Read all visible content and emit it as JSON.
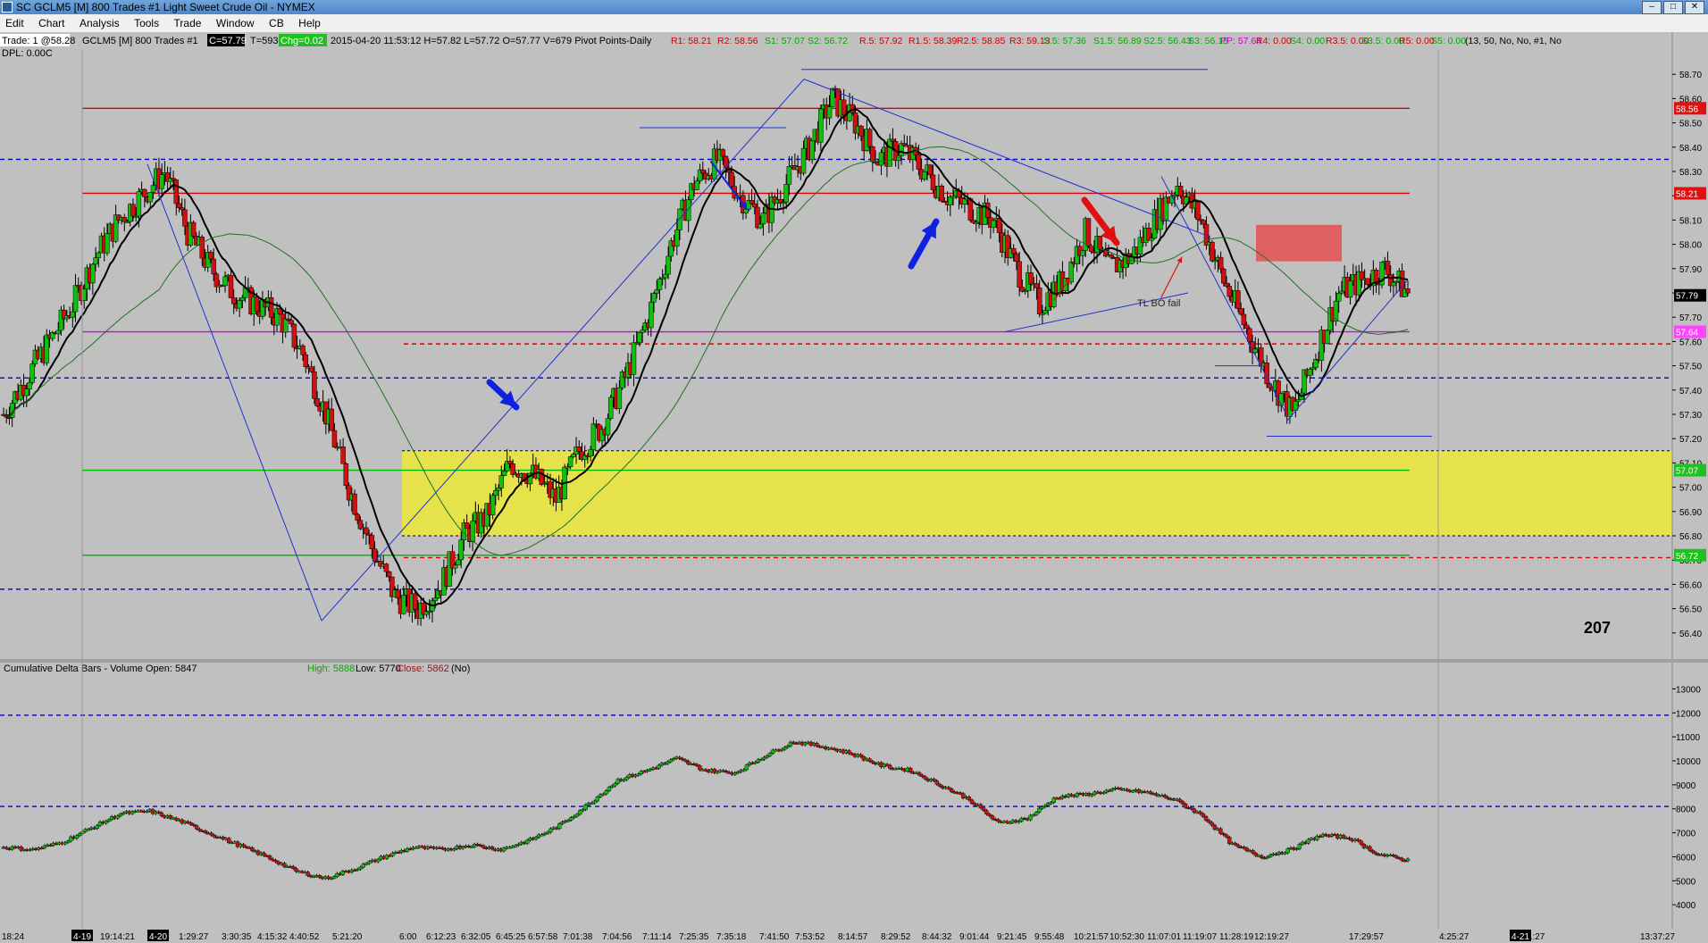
{
  "window": {
    "title": "SC GCLM5 [M]  800 Trades  #1  Light Sweet Crude Oil - NYMEX"
  },
  "menu": [
    "Edit",
    "Chart",
    "Analysis",
    "Tools",
    "Trade",
    "Window",
    "CB",
    "Help"
  ],
  "header": {
    "trade_box": "Trade: 1 @58.28",
    "dpl": "DPL: 0.00C",
    "symbol": "GCLM5 [M]  800 Trades  #1",
    "close_badge": "C=57.79",
    "t_badge": "T=593",
    "chg_badge": "Chg=0.02",
    "bar_info": "2015-04-20 11:53:12 H=57.82 L=57.72 O=57.77 V=679 Pivot Points-Daily",
    "pivots": [
      {
        "text": "R1: 58.21",
        "color": "#cc0000"
      },
      {
        "text": "R2: 58.56",
        "color": "#cc0000"
      },
      {
        "text": "S1: 57.07",
        "color": "#00aa00"
      },
      {
        "text": "S2: 56.72",
        "color": "#00aa00"
      },
      {
        "text": "R.5: 57.92",
        "color": "#cc0000"
      },
      {
        "text": "R1.5: 58.39",
        "color": "#cc0000"
      },
      {
        "text": "R2.5: 58.85",
        "color": "#cc0000"
      },
      {
        "text": "R3: 59.13",
        "color": "#cc0000"
      },
      {
        "text": "S.5: 57.36",
        "color": "#00aa00"
      },
      {
        "text": "S1.5: 56.89",
        "color": "#00aa00"
      },
      {
        "text": "S2.5: 56.43",
        "color": "#00aa00"
      },
      {
        "text": "S3: 56.15",
        "color": "#00aa00"
      },
      {
        "text": "PP: 57.64",
        "color": "#cc00cc"
      },
      {
        "text": "R4: 0.00",
        "color": "#cc0000"
      },
      {
        "text": "S4: 0.00",
        "color": "#00aa00"
      },
      {
        "text": "R3.5: 0.00",
        "color": "#cc0000"
      },
      {
        "text": "S3.5: 0.00",
        "color": "#00aa00"
      },
      {
        "text": "R5: 0.00",
        "color": "#cc0000"
      },
      {
        "text": "S5: 0.00",
        "color": "#00aa00"
      },
      {
        "text": "(13, 50, No, No, #1, No",
        "color": "#000000"
      }
    ]
  },
  "lower_header": {
    "title": "Cumulative Delta Bars - Volume  Open: 5847",
    "high": "High: 5888",
    "low": "Low: 5770",
    "close": "Close: 5862",
    "tail": "(No)"
  },
  "annotations": {
    "tl_bo_fail": "TL BO fail",
    "count": "207"
  },
  "price_badges": [
    {
      "text": "58.56",
      "bg": "#e01010",
      "fg": "#ffffff",
      "value": 58.56
    },
    {
      "text": "58.21",
      "bg": "#e01010",
      "fg": "#ffffff",
      "value": 58.21
    },
    {
      "text": "57.79",
      "bg": "#000000",
      "fg": "#ffffff",
      "value": 57.79
    },
    {
      "text": "57.64",
      "bg": "#ff44ff",
      "fg": "#ffffff",
      "value": 57.64
    },
    {
      "text": "57.07",
      "bg": "#20c020",
      "fg": "#ffffff",
      "value": 57.07
    },
    {
      "text": "56.72",
      "bg": "#20c020",
      "fg": "#ffffff",
      "value": 56.72
    }
  ],
  "date_markers": [
    "4-19",
    "4-20",
    "4-21"
  ],
  "chart_data": [
    {
      "type": "candlestick",
      "title": "GCLM5 [M] 800 Trades",
      "ylim": [
        56.3,
        58.8
      ],
      "y_ticks": [
        "58.70",
        "58.60",
        "58.50",
        "58.40",
        "58.30",
        "58.20",
        "58.10",
        "58.00",
        "57.90",
        "57.80",
        "57.70",
        "57.60",
        "57.50",
        "57.40",
        "57.30",
        "57.20",
        "57.10",
        "57.00",
        "56.90",
        "56.80",
        "56.70",
        "56.60",
        "56.50",
        "56.40"
      ],
      "x_ticks": [
        "18:24",
        "19:14:21",
        "1:29:27",
        "3:30:35",
        "4:15:32",
        "4:40:52",
        "5:21:20",
        "6:00",
        "6:12:23",
        "6:32:05",
        "6:45:25",
        "6:57:58",
        "7:01:38",
        "7:04:56",
        "7:11:14",
        "7:25:35",
        "7:35:18",
        "7:41:50",
        "7:53:52",
        "8:14:57",
        "8:29:52",
        "8:44:32",
        "9:01:44",
        "9:21:45",
        "9:55:48",
        "10:21:57",
        "10:52:30",
        "11:07:01",
        "11:19:07",
        "11:28:19",
        "12:19:27",
        "17:29:57",
        "4:25:27",
        "9:01:27",
        "13:37:27"
      ],
      "close_path": [
        57.3,
        57.45,
        57.6,
        57.75,
        57.95,
        58.1,
        58.2,
        58.3,
        58.05,
        57.9,
        57.8,
        57.75,
        57.7,
        57.55,
        57.3,
        57.0,
        56.75,
        56.55,
        56.5,
        56.6,
        56.8,
        56.88,
        57.1,
        57.05,
        56.95,
        57.15,
        57.25,
        57.45,
        57.7,
        58.0,
        58.25,
        58.35,
        58.2,
        58.1,
        58.25,
        58.4,
        58.6,
        58.5,
        58.35,
        58.4,
        58.3,
        58.2,
        58.15,
        58.1,
        57.9,
        57.75,
        57.85,
        58.05,
        57.9,
        57.95,
        58.1,
        58.25,
        58.1,
        57.85,
        57.65,
        57.45,
        57.3,
        57.55,
        57.8,
        57.85,
        57.9,
        57.8
      ],
      "levels": [
        {
          "name": "R2",
          "value": 58.56,
          "color": "#dd0000",
          "style": "solid"
        },
        {
          "name": "R1",
          "value": 58.21,
          "color": "#dd0000",
          "style": "solid"
        },
        {
          "name": "PP",
          "value": 57.64,
          "color": "#dd00dd",
          "style": "solid"
        },
        {
          "name": "S1",
          "value": 57.07,
          "color": "#00bb00",
          "style": "solid"
        },
        {
          "name": "S2",
          "value": 56.72,
          "color": "#00bb00",
          "style": "solid"
        },
        {
          "name": "upper-blue",
          "value": 58.35,
          "color": "#0000cc",
          "style": "dashed"
        },
        {
          "name": "mid-blue",
          "value": 57.45,
          "color": "#0000cc",
          "style": "dashed"
        },
        {
          "name": "low-blue",
          "value": 56.58,
          "color": "#0000cc",
          "style": "dashed"
        },
        {
          "name": "red-dash-1",
          "value": 57.59,
          "color": "#dd0000",
          "style": "dashed"
        },
        {
          "name": "red-dash-2",
          "value": 56.71,
          "color": "#dd0000",
          "style": "dashed"
        }
      ],
      "zones": [
        {
          "name": "yellow-zone",
          "from": 56.8,
          "to": 57.15,
          "color": "#e6e24c"
        },
        {
          "name": "red-box",
          "from": 57.93,
          "to": 58.08,
          "color": "#e06060"
        }
      ]
    },
    {
      "type": "bar",
      "title": "Cumulative Delta Bars - Volume",
      "ylim": [
        3000,
        13500
      ],
      "y_ticks": [
        "13000",
        "12000",
        "11000",
        "10000",
        "9000",
        "8000",
        "7000",
        "6000",
        "5000",
        "4000"
      ],
      "open": 5847,
      "high": 5888,
      "low": 5770,
      "close": 5862,
      "close_path": [
        6400,
        6300,
        6600,
        7200,
        7800,
        7900,
        7500,
        7000,
        6500,
        6000,
        5400,
        5100,
        5500,
        6000,
        6400,
        6300,
        6500,
        6300,
        6700,
        7300,
        8200,
        9200,
        9600,
        10100,
        9600,
        9500,
        10200,
        10800,
        10600,
        10300,
        9800,
        9600,
        9000,
        8400,
        7400,
        7600,
        8500,
        8600,
        8800,
        8700,
        8400,
        7700,
        6500,
        6000,
        6300,
        6900,
        6800,
        6100,
        5860
      ],
      "levels": [
        {
          "value": 11900,
          "color": "#0000cc",
          "style": "dashed"
        },
        {
          "value": 8100,
          "color": "#0000cc",
          "style": "dashed"
        }
      ]
    }
  ]
}
